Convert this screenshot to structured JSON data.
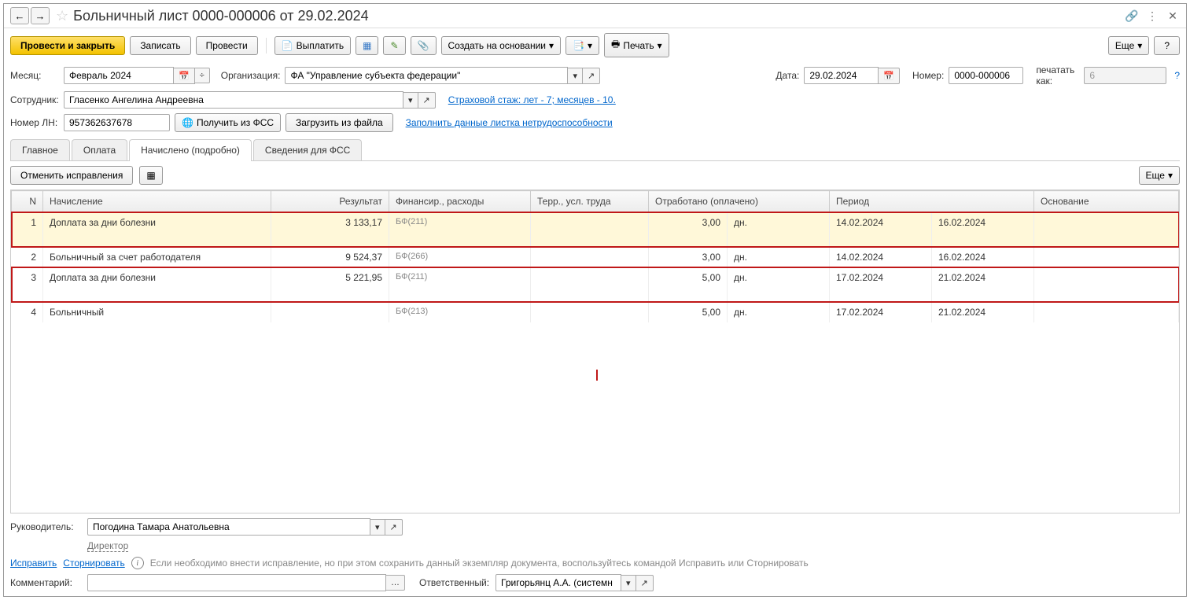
{
  "title": "Больничный лист 0000-000006 от 29.02.2024",
  "toolbar": {
    "post_close": "Провести и закрыть",
    "save": "Записать",
    "post": "Провести",
    "pay": "Выплатить",
    "create_based": "Создать на основании",
    "print": "Печать",
    "more": "Еще",
    "help": "?"
  },
  "fields": {
    "month_label": "Месяц:",
    "month_value": "Февраль 2024",
    "org_label": "Организация:",
    "org_value": "ФА \"Управление субъекта федерации\"",
    "date_label": "Дата:",
    "date_value": "29.02.2024",
    "number_label": "Номер:",
    "number_value": "0000-000006",
    "print_as_label": "печатать как:",
    "print_as_value": "6",
    "employee_label": "Сотрудник:",
    "employee_value": "Гласенко Ангелина Андреевна",
    "insurance_link": "Страховой стаж: лет - 7; месяцев - 10.",
    "ln_label": "Номер ЛН:",
    "ln_value": "957362637678",
    "get_fss": "Получить из ФСС",
    "load_file": "Загрузить из файла",
    "fill_link": "Заполнить данные листка нетрудоспособности"
  },
  "tabs": {
    "main": "Главное",
    "payment": "Оплата",
    "accrued": "Начислено (подробно)",
    "fss": "Сведения для ФСС"
  },
  "sub": {
    "cancel": "Отменить исправления",
    "more": "Еще"
  },
  "table": {
    "headers": {
      "n": "N",
      "name": "Начисление",
      "result": "Результат",
      "fin": "Финансир., расходы",
      "terr": "Терр., усл. труда",
      "worked": "Отработано (оплачено)",
      "period": "Период",
      "basis": "Основание"
    },
    "rows": [
      {
        "n": "1",
        "name": "Доплата за дни болезни",
        "result": "3 133,17",
        "fin": "БФ(211)",
        "worked": "3,00",
        "unit": "дн.",
        "p1": "14.02.2024",
        "p2": "16.02.2024",
        "sel": true,
        "red": true,
        "tall": true
      },
      {
        "n": "2",
        "name": "Больничный за счет работодателя",
        "result": "9 524,37",
        "fin": "БФ(266)",
        "worked": "3,00",
        "unit": "дн.",
        "p1": "14.02.2024",
        "p2": "16.02.2024",
        "sel": false,
        "red": false,
        "tall": false
      },
      {
        "n": "3",
        "name": "Доплата за дни болезни",
        "result": "5 221,95",
        "fin": "БФ(211)",
        "worked": "5,00",
        "unit": "дн.",
        "p1": "17.02.2024",
        "p2": "21.02.2024",
        "sel": false,
        "red": true,
        "tall": true
      },
      {
        "n": "4",
        "name": "Больничный",
        "result": "",
        "fin": "БФ(213)",
        "worked": "5,00",
        "unit": "дн.",
        "p1": "17.02.2024",
        "p2": "21.02.2024",
        "sel": false,
        "red": false,
        "tall": false
      }
    ]
  },
  "footer": {
    "manager_label": "Руководитель:",
    "manager_value": "Погодина Тамара Анатольевна",
    "director": "Директор",
    "fix": "Исправить",
    "storno": "Сторнировать",
    "info": "Если необходимо внести исправление, но при этом сохранить данный экземпляр документа, воспользуйтесь командой Исправить или Сторнировать",
    "comment_label": "Комментарий:",
    "resp_label": "Ответственный:",
    "resp_value": "Григорьянц А.А. (системн"
  }
}
